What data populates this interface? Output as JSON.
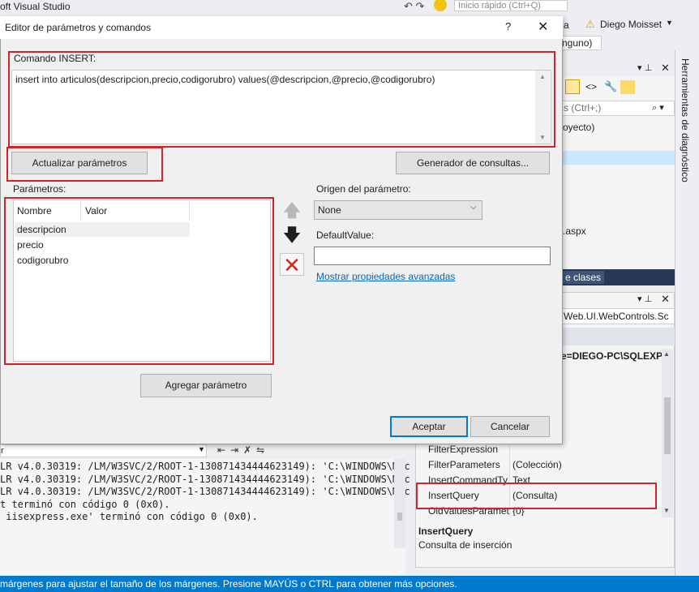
{
  "vs": {
    "title_fragment": "oft Visual Studio",
    "quick_launch_placeholder": "Inicio rápido (Ctrl+Q)",
    "menu_fragment": "a",
    "user_name": "Diego Moisset",
    "config_fragment": "nguno)"
  },
  "solution_explorer": {
    "search_placeholder": "s (Ctrl+;)",
    "project_fragment": "oyecto)",
    "file_fragment": ".aspx",
    "tab_label": "e clases"
  },
  "right_vertical_tab": "Herramientas de diagnóstico",
  "properties": {
    "object_fragment": "Web.UI.WebControls.Sc",
    "connection_fragment": "e=DIEGO-PC\\SQLEXP",
    "rows": [
      {
        "name": "FilterExpression",
        "value": ""
      },
      {
        "name": "FilterParameters",
        "value": "(Colección)"
      },
      {
        "name": "InsertCommandTy",
        "value": "Text"
      },
      {
        "name": "InsertQuery",
        "value": "(Consulta)"
      },
      {
        "name": "OldValuesParamet",
        "value": "{0}"
      }
    ],
    "description_name": "InsertQuery",
    "description_text": "Consulta de inserción"
  },
  "output": {
    "combo_fragment": "r",
    "lines": [
      "LR v4.0.30319: /LM/W3SVC/2/ROOT-1-130871434444623149): 'C:\\WINDOWS\\Mic",
      "LR v4.0.30319: /LM/W3SVC/2/ROOT-1-130871434444623149): 'C:\\WINDOWS\\Mic",
      "LR v4.0.30319: /LM/W3SVC/2/ROOT-1-130871434444623149): 'C:\\WINDOWS\\Mic",
      "t terminó con código 0 (0x0).",
      " iisexpress.exe' terminó con código 0 (0x0)."
    ]
  },
  "status_bar": "márgenes para ajustar el tamaño de los márgenes. Presione MAYÚS o CTRL para obtener más opciones.",
  "dialog": {
    "title": "Editor de parámetros y comandos",
    "help": "?",
    "command_label": "Comando INSERT:",
    "command_text": "insert into articulos(descripcion,precio,codigorubro) values(@descripcion,@precio,@codigorubro)",
    "refresh_button": "Actualizar parámetros",
    "query_builder_button": "Generador de consultas...",
    "parameters_label": "Parámetros:",
    "columns": {
      "name": "Nombre",
      "value": "Valor"
    },
    "parameters": [
      "descripcion",
      "precio",
      "codigorubro"
    ],
    "origin_label": "Origen del parámetro:",
    "origin_value": "None",
    "default_value_label": "DefaultValue:",
    "default_value": "",
    "advanced_link": "Mostrar propiedades avanzadas",
    "add_parameter_button": "Agregar parámetro",
    "ok_button": "Aceptar",
    "cancel_button": "Cancelar"
  },
  "colors": {
    "highlight": "#d2232a",
    "status_bar": "#007acc",
    "link": "#0066cc",
    "primary_button_border": "#0078d7"
  }
}
